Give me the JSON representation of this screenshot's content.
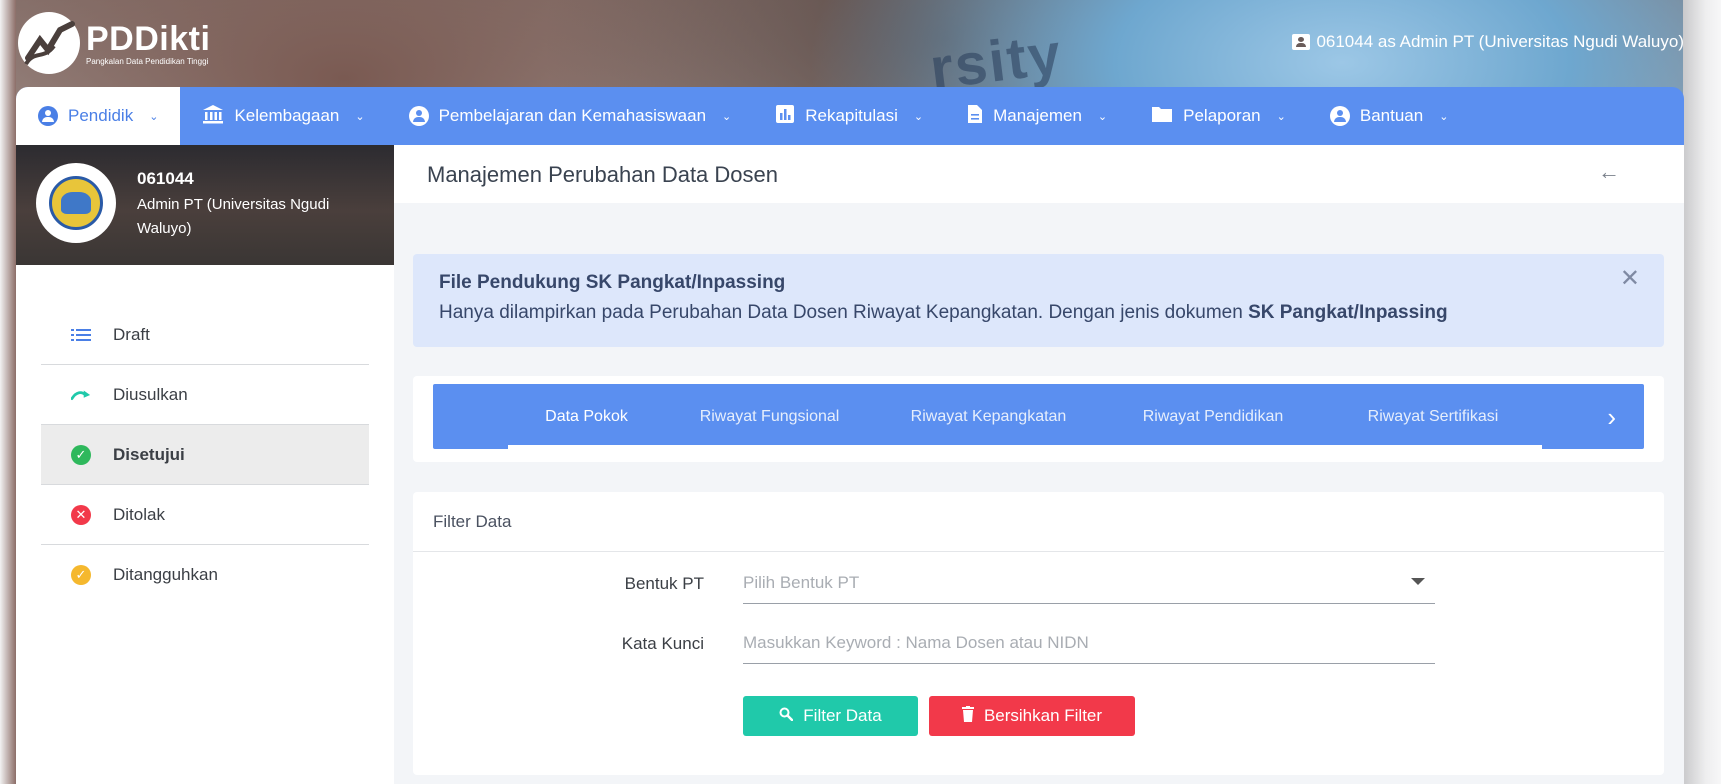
{
  "app": {
    "logo_title": "PDDikti",
    "logo_subtitle": "Pangkalan Data Pendidikan Tinggi",
    "user_info": "061044 as Admin PT (Universitas Ngudi Waluyo)",
    "background_word": "rsity"
  },
  "nav": {
    "items": [
      {
        "label": "Pendidik",
        "icon": "user-circle-icon"
      },
      {
        "label": "Kelembagaan",
        "icon": "institution-icon"
      },
      {
        "label": "Pembelajaran dan Kemahasiswaan",
        "icon": "user-circle-icon"
      },
      {
        "label": "Rekapitulasi",
        "icon": "bar-chart-icon"
      },
      {
        "label": "Manajemen",
        "icon": "document-icon"
      },
      {
        "label": "Pelaporan",
        "icon": "folder-icon"
      },
      {
        "label": "Bantuan",
        "icon": "user-circle-icon"
      }
    ]
  },
  "profile": {
    "id": "061044",
    "role": "Admin PT (Universitas Ngudi Waluyo)"
  },
  "sidebar": {
    "items": [
      {
        "label": "Draft",
        "icon": "list-icon",
        "color": "#4a7fe6"
      },
      {
        "label": "Diusulkan",
        "icon": "send-arrow-icon",
        "color": "#20c9aa"
      },
      {
        "label": "Disetujui",
        "icon": "check-circle-icon",
        "color": "#2eb85c",
        "glyph": "✓"
      },
      {
        "label": "Ditolak",
        "icon": "x-circle-icon",
        "color": "#f2394a",
        "glyph": "✕"
      },
      {
        "label": "Ditangguhkan",
        "icon": "pending-circle-icon",
        "color": "#f5b82e",
        "glyph": "✓"
      }
    ]
  },
  "page": {
    "title": "Manajemen Perubahan Data Dosen"
  },
  "alert": {
    "title": "File Pendukung SK Pangkat/Inpassing",
    "text": "Hanya dilampirkan pada Perubahan Data Dosen Riwayat Kepangkatan. Dengan jenis dokumen ",
    "bold": "SK Pangkat/Inpassing"
  },
  "tabs": {
    "items": [
      {
        "label": "Data Pokok"
      },
      {
        "label": "Riwayat Fungsional"
      },
      {
        "label": "Riwayat Kepangkatan"
      },
      {
        "label": "Riwayat Pendidikan"
      },
      {
        "label": "Riwayat Sertifikasi"
      }
    ]
  },
  "filter": {
    "heading": "Filter Data",
    "bentuk_label": "Bentuk PT",
    "bentuk_placeholder": "Pilih Bentuk PT",
    "kata_label": "Kata Kunci",
    "kata_placeholder": "Masukkan Keyword : Nama Dosen atau NIDN",
    "filter_button": "Filter Data",
    "clear_button": "Bersihkan Filter"
  },
  "colors": {
    "accent": "#5b8ff0",
    "teal": "#20c9aa",
    "danger": "#f2394a",
    "warning": "#f5b82e",
    "tab_indicator": "#f0a33a"
  }
}
